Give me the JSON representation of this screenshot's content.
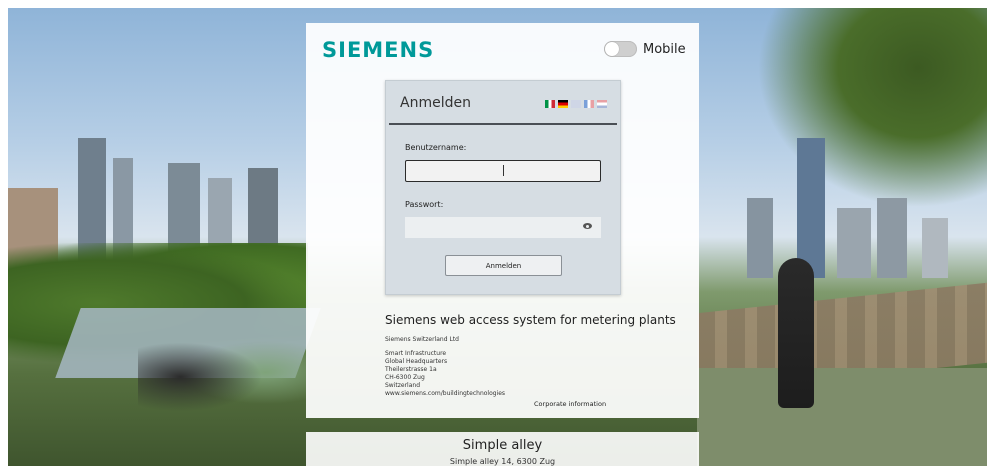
{
  "brand": {
    "logo_text": "SIEMENS",
    "logo_color": "#009999"
  },
  "mobile_toggle": {
    "label": "Mobile",
    "state": "off"
  },
  "login": {
    "title": "Anmelden",
    "languages": [
      "it-flag-icon",
      "de-flag-icon",
      "gb-flag-icon",
      "fr-flag-icon",
      "nl-flag-icon"
    ],
    "username_label": "Benutzername:",
    "username_value": "",
    "password_label": "Passwort:",
    "password_value": "",
    "submit_label": "Anmelden"
  },
  "info": {
    "heading": "Siemens web access system for metering plants",
    "address_lines": [
      "Siemens Switzerland Ltd",
      "Smart Infrastructure",
      "Global Headquarters",
      "Theilerstrasse 1a",
      "CH-6300 Zug",
      "Switzerland",
      "www.siemens.com/buildingtechnologies"
    ],
    "corporate_link": "Corporate information"
  },
  "footer": {
    "title": "Simple alley",
    "subtitle": "Simple alley 14, 6300 Zug"
  }
}
